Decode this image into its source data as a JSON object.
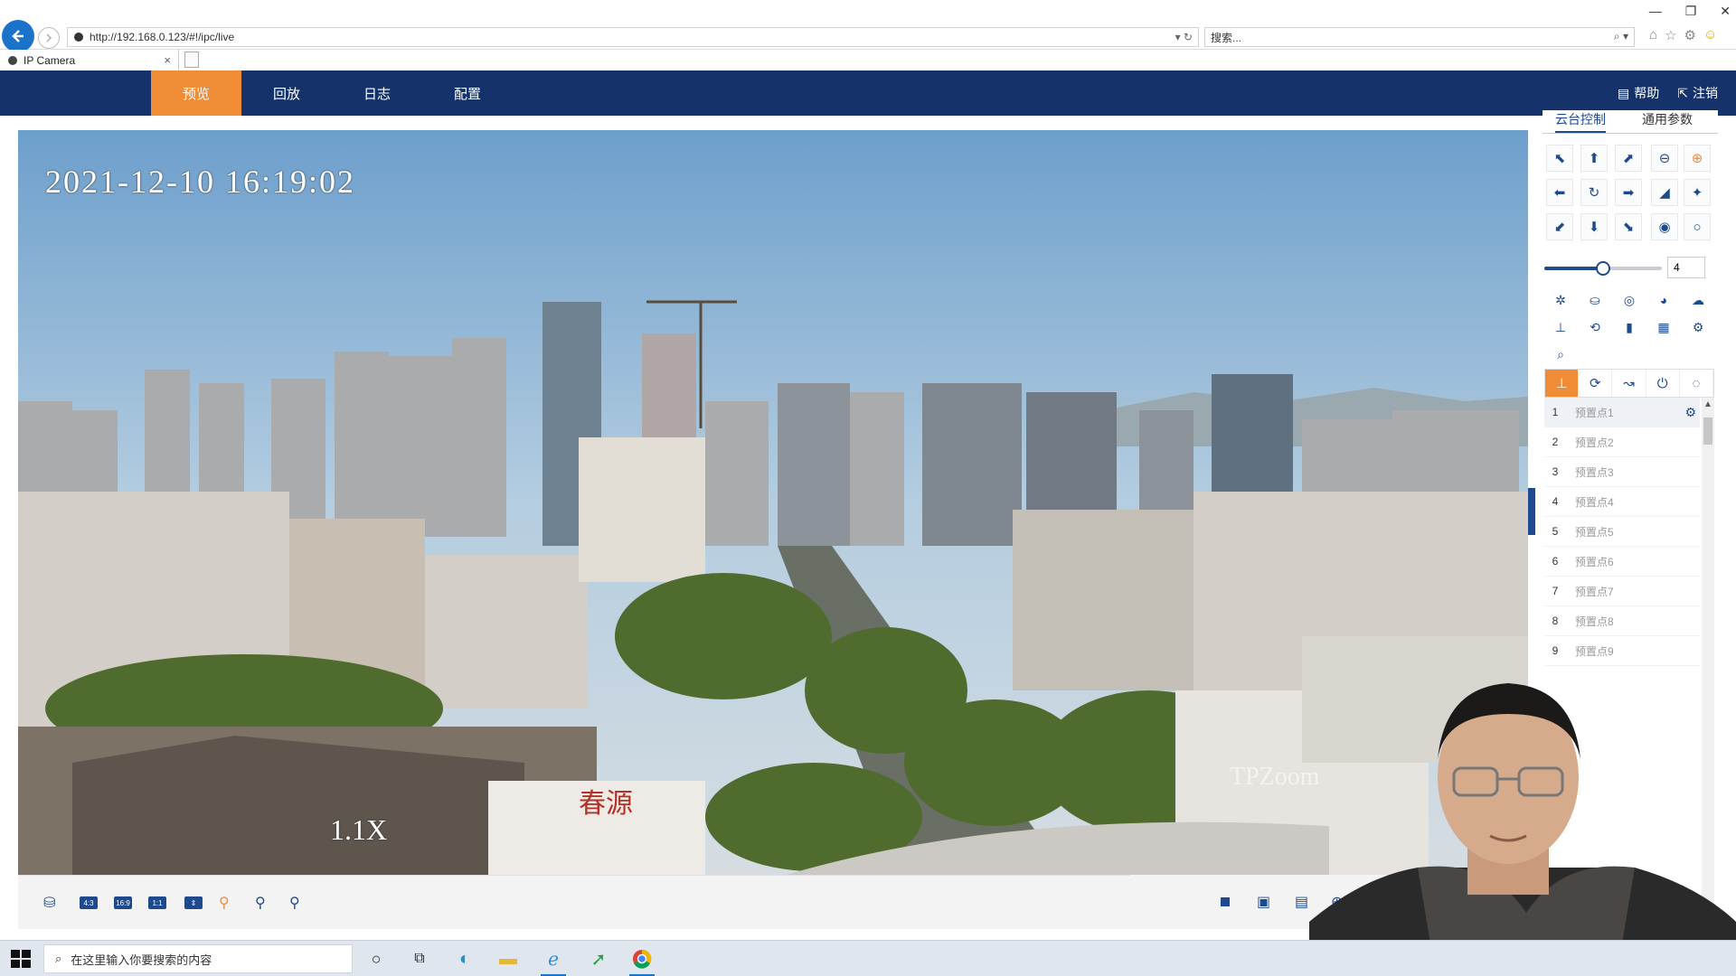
{
  "browser": {
    "url": "http://192.168.0.123/#!/ipc/live",
    "search_placeholder": "搜索...",
    "tab_title": "IP Camera"
  },
  "nav": {
    "items": [
      "预览",
      "回放",
      "日志",
      "配置"
    ],
    "active": "预览",
    "help": "帮助",
    "logout": "注销"
  },
  "video": {
    "osd_time": "2021-12-10  16:19:02",
    "osd_zoom": "1.1X",
    "watermark": "TPZoom"
  },
  "ptz": {
    "tabs": [
      "云台控制",
      "通用参数"
    ],
    "active_tab": "云台控制",
    "speed_value": "4",
    "speed_level": 0.5,
    "presets": [
      {
        "num": "1",
        "name": "预置点1"
      },
      {
        "num": "2",
        "name": "预置点2"
      },
      {
        "num": "3",
        "name": "预置点3"
      },
      {
        "num": "4",
        "name": "预置点4"
      },
      {
        "num": "5",
        "name": "预置点5"
      },
      {
        "num": "6",
        "name": "预置点6"
      },
      {
        "num": "7",
        "name": "预置点7"
      },
      {
        "num": "8",
        "name": "预置点8"
      },
      {
        "num": "9",
        "name": "预置点9"
      }
    ]
  },
  "toolbar": {
    "ratio_4_3": "4:3",
    "ratio_16_9": "16:9",
    "ratio_1_1": "1:1"
  },
  "taskbar": {
    "search_placeholder": "在这里输入你要搜索的内容"
  },
  "colors": {
    "nav_bg": "#16326a",
    "accent": "#f08c36",
    "icon_blue": "#1d4a8e"
  }
}
